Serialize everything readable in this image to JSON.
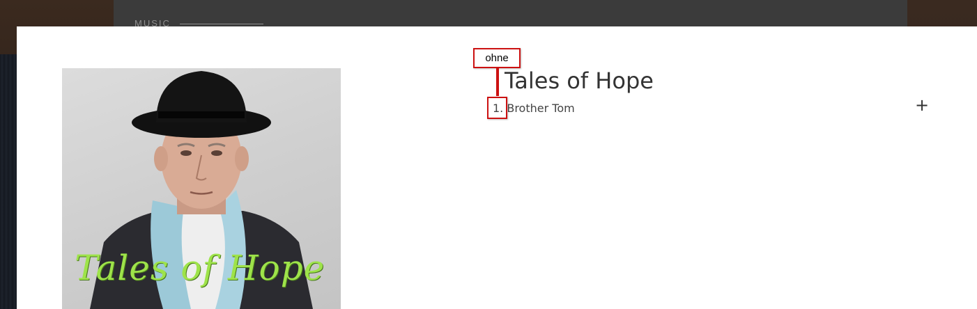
{
  "background": {
    "section_label": "MUSIC"
  },
  "modal": {
    "cover": {
      "overlay_text": "Tales of Hope",
      "text_color": "#9ee34a"
    },
    "album": {
      "title": "Tales of Hope",
      "tracks": [
        {
          "label": "1. Brother Tom"
        }
      ],
      "expand_symbol": "+"
    }
  },
  "annotation": {
    "label": "ohne",
    "color": "#cc1111"
  }
}
